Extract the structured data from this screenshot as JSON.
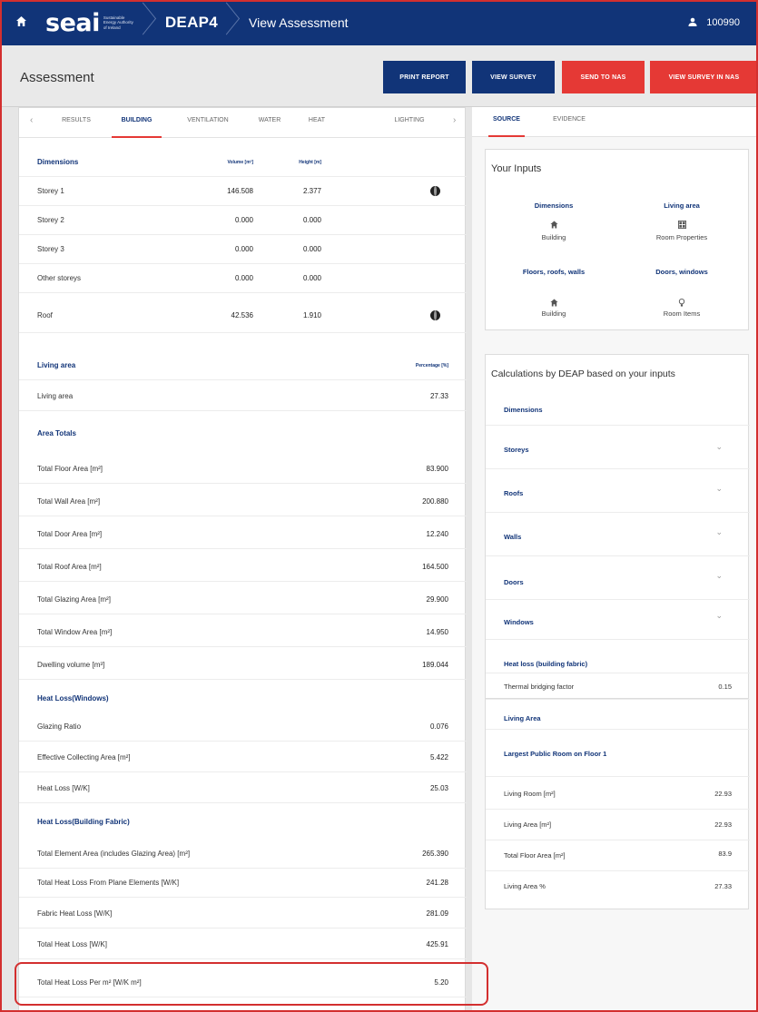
{
  "nav": {
    "logo_word": "seai",
    "logo_tagline": "Sustainable Energy Authority of Ireland",
    "app_name": "DEAP4",
    "page": "View Assessment",
    "user_id": "100990"
  },
  "header": {
    "title": "Assessment",
    "buttons": {
      "print_report": "PRINT REPORT",
      "view_survey": "VIEW SURVEY",
      "send_to_nas": "SEND TO NAS",
      "view_survey_in_nas": "VIEW SURVEY IN NAS"
    }
  },
  "left_tabs": [
    "RESULTS",
    "BUILDING",
    "VENTILATION",
    "WATER",
    "HEAT",
    "LIGHTING"
  ],
  "left_active_tab": "BUILDING",
  "dimensions": {
    "heading": "Dimensions",
    "col_volume": "Volume [m³]",
    "col_height": "Height [m]",
    "rows": [
      {
        "label": "Storey 1",
        "volume": "146.508",
        "height": "2.377"
      },
      {
        "label": "Storey 2",
        "volume": "0.000",
        "height": "0.000"
      },
      {
        "label": "Storey 3",
        "volume": "0.000",
        "height": "0.000"
      },
      {
        "label": "Other storeys",
        "volume": "0.000",
        "height": "0.000"
      },
      {
        "label": "Roof",
        "volume": "42.536",
        "height": "1.910"
      }
    ]
  },
  "living_area": {
    "heading": "Living area",
    "col_percentage": "Percentage [%]",
    "label": "Living area",
    "value": "27.33"
  },
  "area_totals": {
    "heading": "Area Totals",
    "rows": [
      {
        "label": "Total Floor Area [m²]",
        "value": "83.900"
      },
      {
        "label": "Total Wall Area [m²]",
        "value": "200.880"
      },
      {
        "label": "Total Door Area [m²]",
        "value": "12.240"
      },
      {
        "label": "Total Roof Area [m²]",
        "value": "164.500"
      },
      {
        "label": "Total Glazing Area [m²]",
        "value": "29.900"
      },
      {
        "label": "Total Window Area [m²]",
        "value": "14.950"
      },
      {
        "label": "Dwelling volume [m³]",
        "value": "189.044"
      }
    ]
  },
  "heat_loss_windows": {
    "heading": "Heat Loss(Windows)",
    "rows": [
      {
        "label": "Glazing Ratio",
        "value": "0.076"
      },
      {
        "label": "Effective Collecting Area [m²]",
        "value": "5.422"
      },
      {
        "label": "Heat Loss [W/K]",
        "value": "25.03"
      }
    ]
  },
  "heat_loss_fabric": {
    "heading": "Heat Loss(Building Fabric)",
    "rows": [
      {
        "label": "Total Element Area (includes Glazing Area) [m²]",
        "value": "265.390"
      },
      {
        "label": "Total Heat Loss From Plane Elements [W/K]",
        "value": "241.28"
      },
      {
        "label": "Fabric Heat Loss [W/K]",
        "value": "281.09"
      },
      {
        "label": "Total Heat Loss [W/K]",
        "value": "425.91"
      },
      {
        "label": "Total Heat Loss Per m² [W/K m²]",
        "value": "5.20"
      }
    ]
  },
  "right_tabs": [
    "SOURCE",
    "EVIDENCE"
  ],
  "right_active_tab": "SOURCE",
  "inputs_card": {
    "title": "Your Inputs",
    "items": [
      {
        "heading": "Dimensions",
        "icon": "home-icon",
        "label": "Building"
      },
      {
        "heading": "Living area",
        "icon": "grid-icon",
        "label": "Room Properties"
      },
      {
        "heading": "Floors, roofs, walls",
        "icon": "home-icon",
        "label": "Building"
      },
      {
        "heading": "Doors, windows",
        "icon": "lightbulb-icon",
        "label": "Room Items"
      }
    ]
  },
  "calc_card": {
    "title": "Calculations by DEAP based on your inputs",
    "dimensions_heading": "Dimensions",
    "expandables": [
      "Storeys",
      "Roofs",
      "Walls",
      "Doors",
      "Windows"
    ],
    "heat_loss_heading": "Heat loss (building fabric)",
    "thermal_label": "Thermal bridging factor",
    "thermal_value": "0.15",
    "living_heading": "Living Area",
    "largest_room_heading": "Largest Public Room on Floor 1",
    "living_rows": [
      {
        "label": "Living Room [m²]",
        "value": "22.93"
      },
      {
        "label": "Living Area [m²]",
        "value": "22.93"
      },
      {
        "label": "Total Floor Area [m²]",
        "value": "83.9"
      },
      {
        "label": "Living Area %",
        "value": "27.33"
      }
    ]
  },
  "colors": {
    "navy": "#113478",
    "red": "#e53935",
    "highlight": "#d32f2f"
  }
}
